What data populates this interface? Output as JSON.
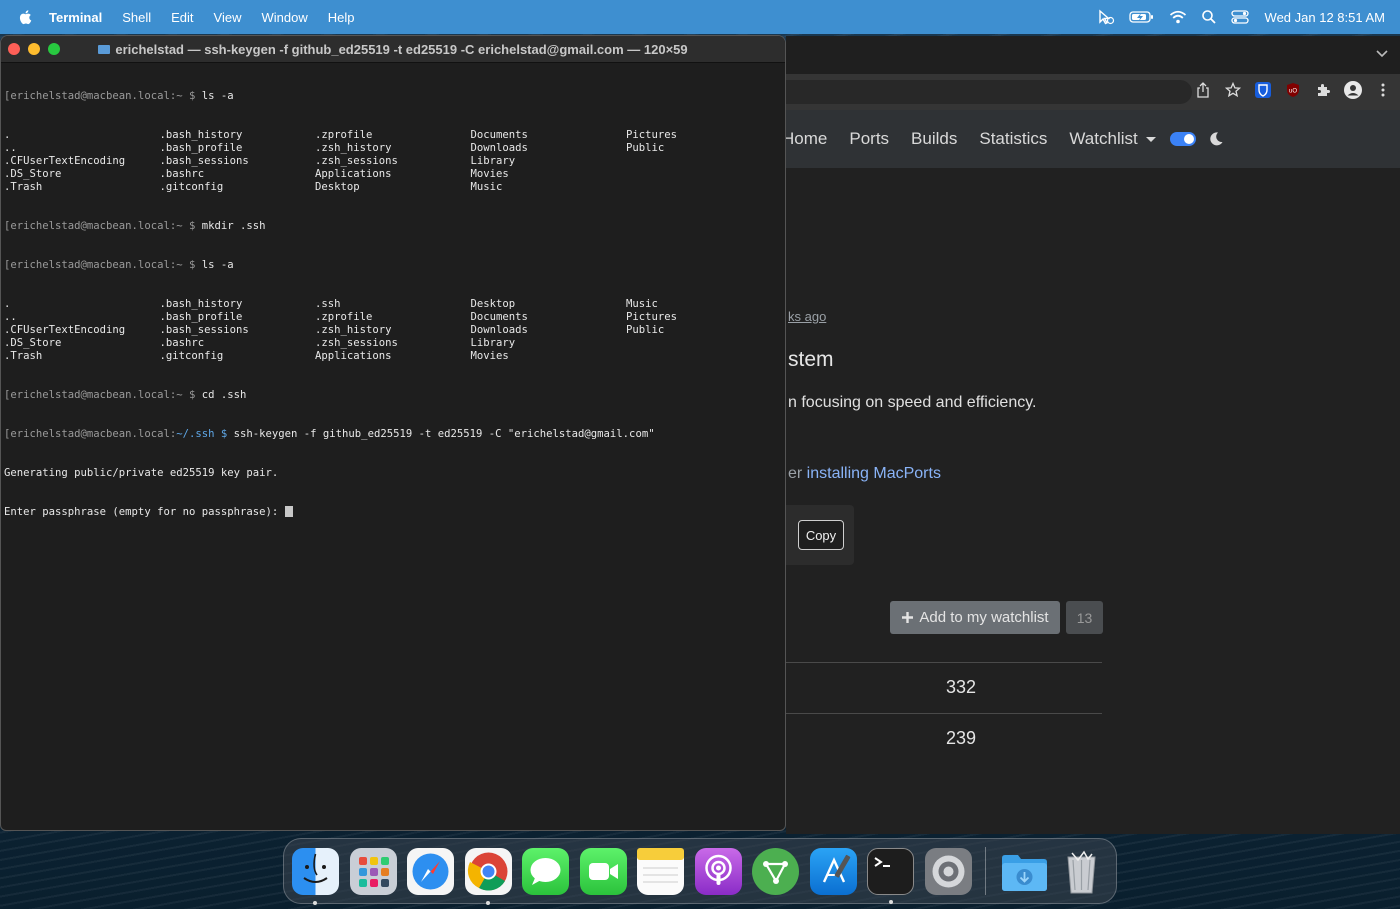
{
  "menubar": {
    "app_name": "Terminal",
    "items": [
      "Shell",
      "Edit",
      "View",
      "Window",
      "Help"
    ],
    "datetime": "Wed Jan 12  8:51 AM",
    "status_icons": [
      "cursor-icon",
      "battery-icon",
      "wifi-icon",
      "spotlight-search-icon",
      "control-center-icon"
    ]
  },
  "terminal": {
    "title": "erichelstad — ssh-keygen -f github_ed25519 -t ed25519 -C erichelstad@gmail.com — 120×59",
    "prompt_home": "[erichelstad@macbean.local:~ $",
    "prompt_ssh_user": "[erichelstad@macbean.local:",
    "prompt_ssh_path": "~/.ssh $",
    "cmd1": " ls -a",
    "listing1": [
      [
        ".",
        ".bash_history",
        ".zprofile",
        "Documents",
        "Pictures"
      ],
      [
        "..",
        ".bash_profile",
        ".zsh_history",
        "Downloads",
        "Public"
      ],
      [
        ".CFUserTextEncoding",
        ".bash_sessions",
        ".zsh_sessions",
        "Library",
        ""
      ],
      [
        ".DS_Store",
        ".bashrc",
        "Applications",
        "Movies",
        ""
      ],
      [
        ".Trash",
        ".gitconfig",
        "Desktop",
        "Music",
        ""
      ]
    ],
    "cmd2": " mkdir .ssh",
    "cmd3": " ls -a",
    "listing2": [
      [
        ".",
        ".bash_history",
        ".ssh",
        "Desktop",
        "Music"
      ],
      [
        "..",
        ".bash_profile",
        ".zprofile",
        "Documents",
        "Pictures"
      ],
      [
        ".CFUserTextEncoding",
        ".bash_sessions",
        ".zsh_history",
        "Downloads",
        "Public"
      ],
      [
        ".DS_Store",
        ".bashrc",
        ".zsh_sessions",
        "Library",
        ""
      ],
      [
        ".Trash",
        ".gitconfig",
        "Applications",
        "Movies",
        ""
      ]
    ],
    "cmd4": " cd .ssh",
    "cmd5": " ssh-keygen -f github_ed25519 -t ed25519 -C \"erichelstad@gmail.com\"",
    "out1": "Generating public/private ed25519 key pair.",
    "out2": "Enter passphrase (empty for no passphrase): "
  },
  "browser": {
    "nav": [
      "Home",
      "Ports",
      "Builds",
      "Statistics",
      "Watchlist"
    ],
    "time_ago": "ks ago",
    "heading_fragment": "stem",
    "description_fragment": "n focusing on speed and efficiency.",
    "install_prefix": "er ",
    "install_link": "installing MacPorts",
    "copy_label": "Copy",
    "watchlist_button": "Add to my watchlist",
    "watchlist_count": "13",
    "stats": [
      "332",
      "239"
    ],
    "toolbar_icons": [
      "share-icon",
      "bookmark-star-icon",
      "bitwarden-icon",
      "ublock-icon",
      "extensions-icon",
      "profile-icon",
      "more-menu-icon"
    ]
  },
  "dock": {
    "apps": [
      "Finder",
      "Launchpad",
      "Safari",
      "Google Chrome",
      "Messages",
      "FaceTime",
      "Notes",
      "Podcasts",
      "Vectorworks",
      "Xcode",
      "Terminal",
      "System Preferences"
    ],
    "others": [
      "Downloads",
      "Trash"
    ]
  },
  "colors": {
    "menubar": "#3e8fd0",
    "terminal_bg": "#1e1e1e",
    "browser_bg": "#212121",
    "accent_blue": "#3b82f6"
  }
}
